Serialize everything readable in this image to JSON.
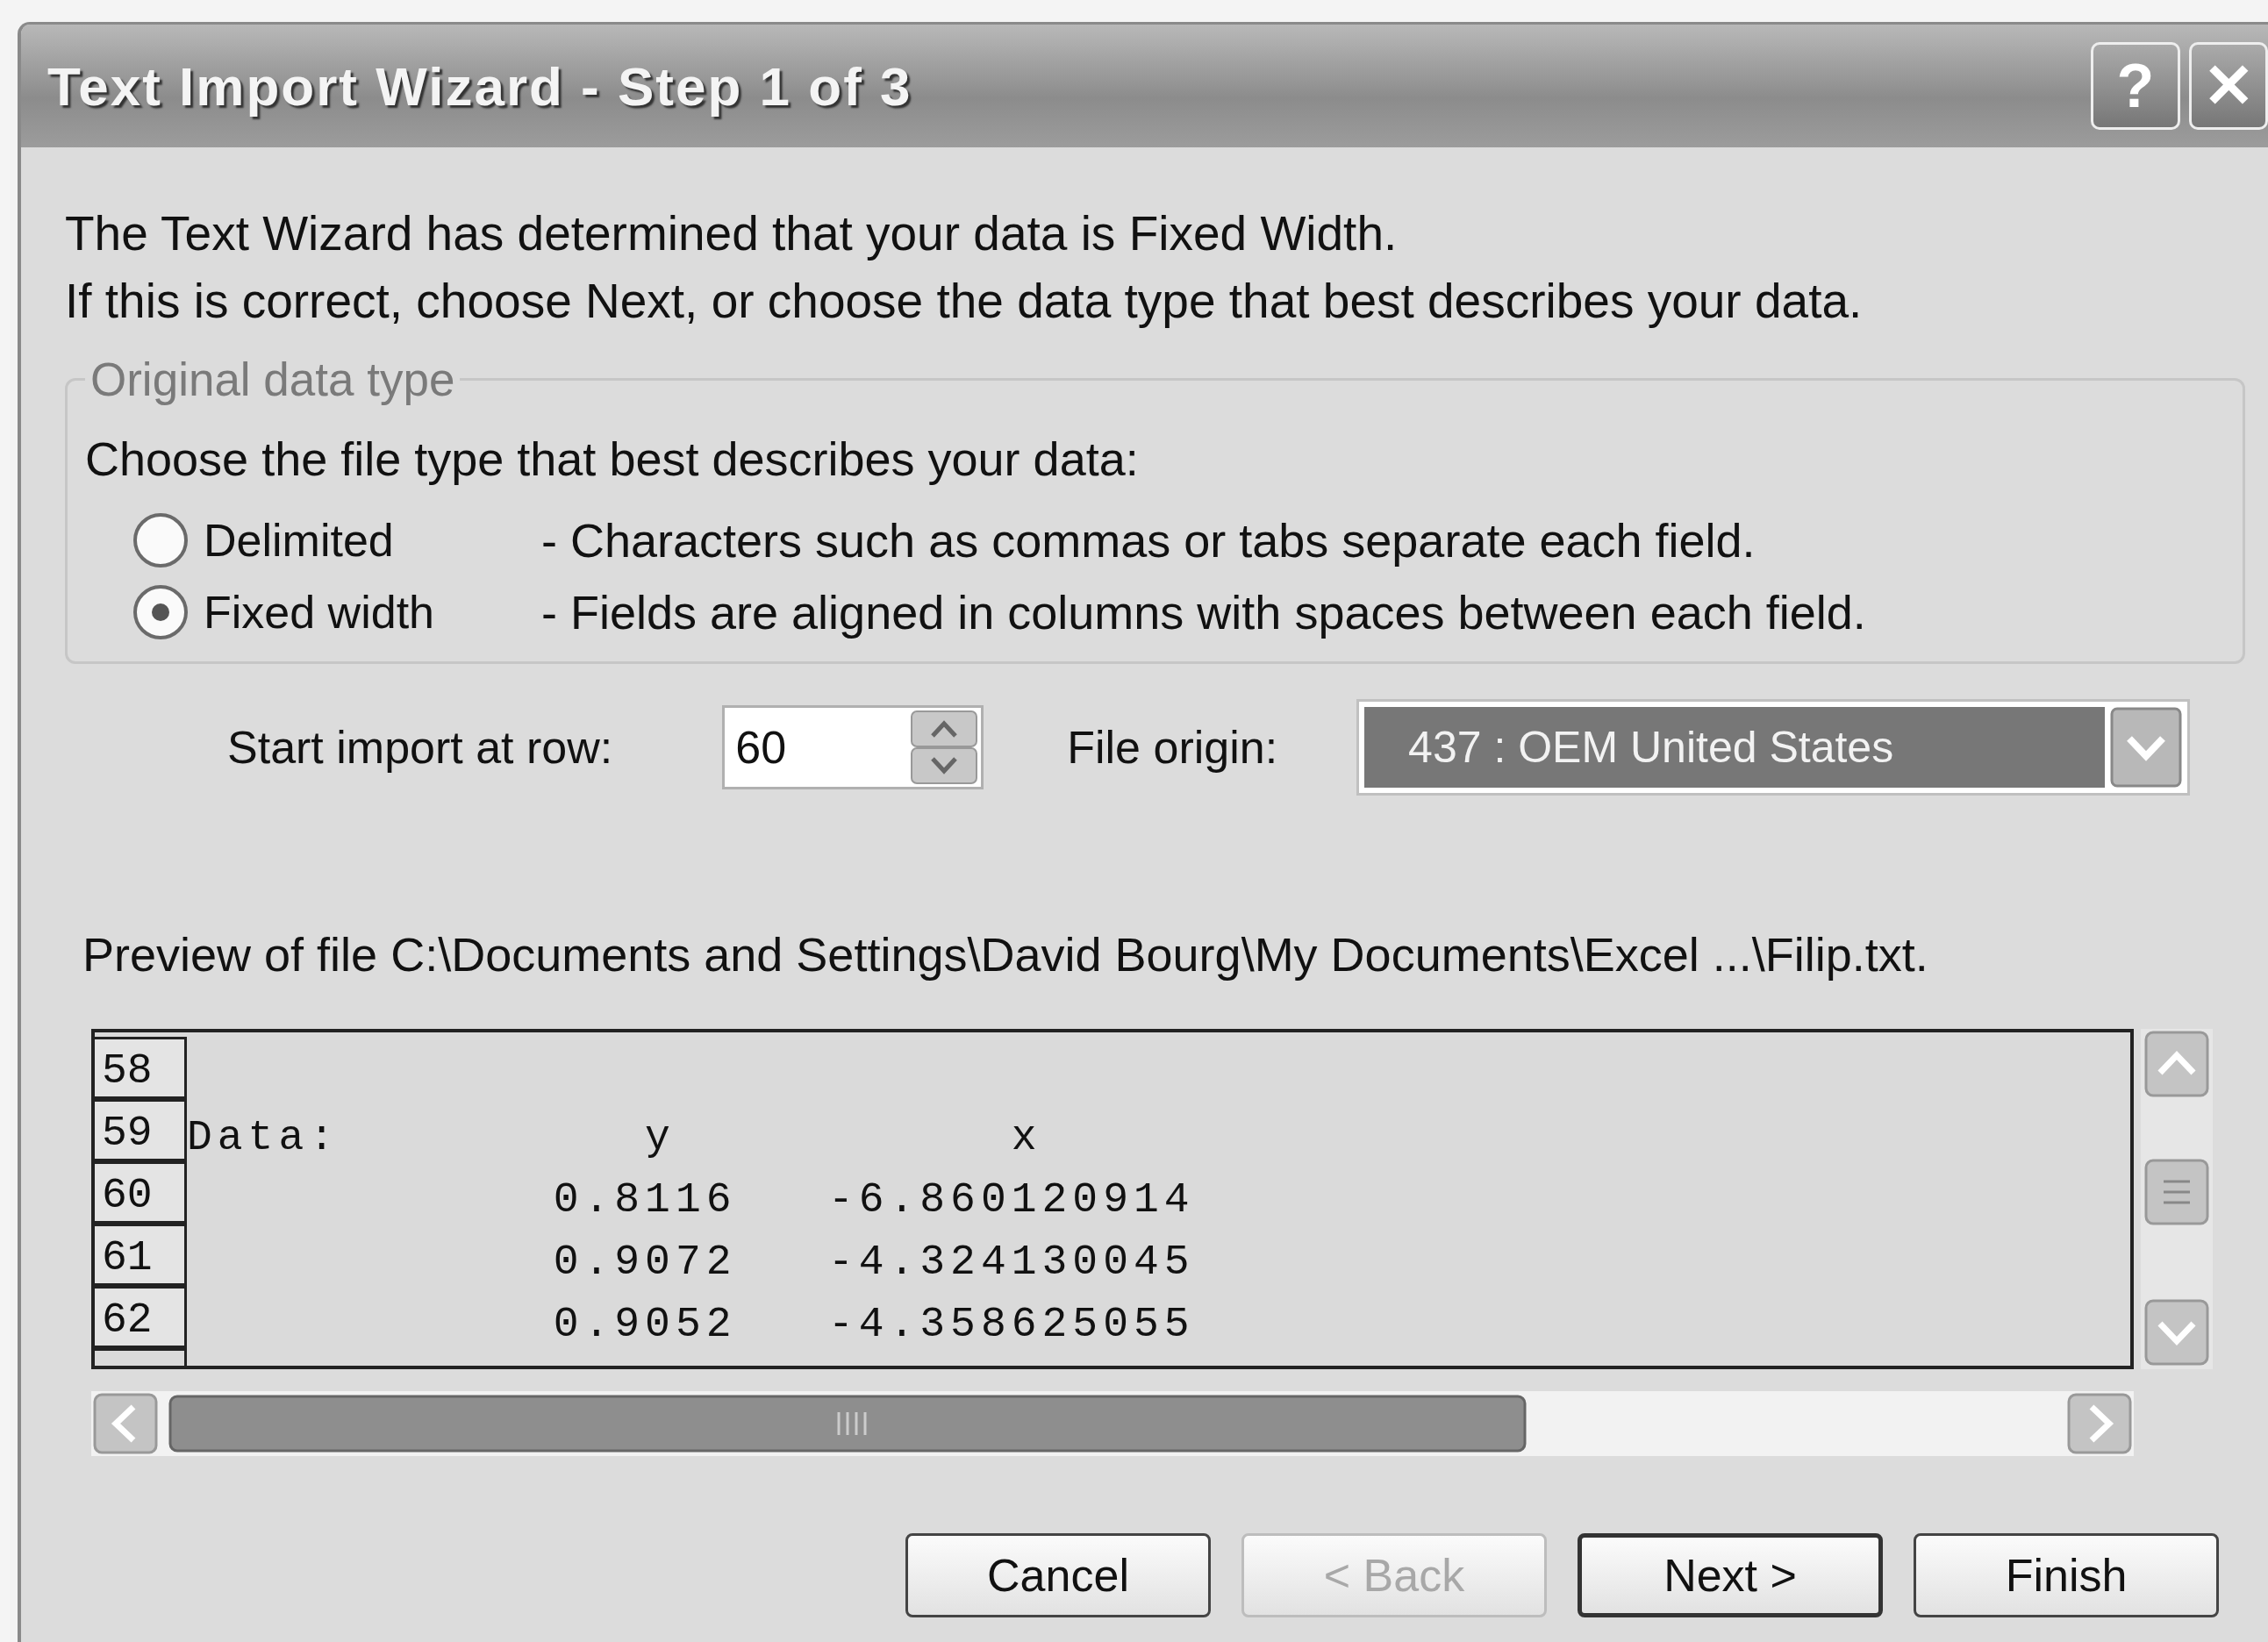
{
  "window": {
    "title": "Text Import Wizard - Step 1 of 3",
    "title_buttons": [
      {
        "kind": "help",
        "label": "?"
      },
      {
        "kind": "close",
        "label": "✕"
      }
    ]
  },
  "intro": [
    "The Text Wizard has determined that your data is Fixed Width.",
    "If this is correct, choose Next, or choose the data type that best describes your data."
  ],
  "data_type_group": {
    "legend": "Original data type",
    "prompt": "Choose the file type that best describes your data:",
    "options": [
      {
        "label": "Delimited",
        "description": "- Characters such as commas or tabs separate each field.",
        "selected": false
      },
      {
        "label": "Fixed width",
        "description": "- Fields are aligned in columns with spaces between each field.",
        "selected": true
      }
    ]
  },
  "start_row": {
    "label": "Start import at row:",
    "value": "60"
  },
  "file_origin": {
    "label": "File origin:",
    "value": "437 : OEM United States",
    "highlighted": true
  },
  "preview": {
    "label": "Preview of file C:\\Documents and Settings\\David Bourg\\My Documents\\Excel ...\\Filip.txt.",
    "rows": [
      {
        "number": "58",
        "text": ""
      },
      {
        "number": "59",
        "text": "Data:          y           x"
      },
      {
        "number": "60",
        "text": "            0.8116   -6.860120914"
      },
      {
        "number": "61",
        "text": "            0.9072   -4.324130045"
      },
      {
        "number": "62",
        "text": "            0.9052   -4.358625055"
      }
    ]
  },
  "buttons": [
    {
      "label": "Cancel",
      "disabled": false,
      "default": false
    },
    {
      "label": "< Back",
      "disabled": true,
      "default": false
    },
    {
      "label": "Next >",
      "disabled": false,
      "default": true
    },
    {
      "label": "Finish",
      "disabled": false,
      "default": false
    }
  ]
}
